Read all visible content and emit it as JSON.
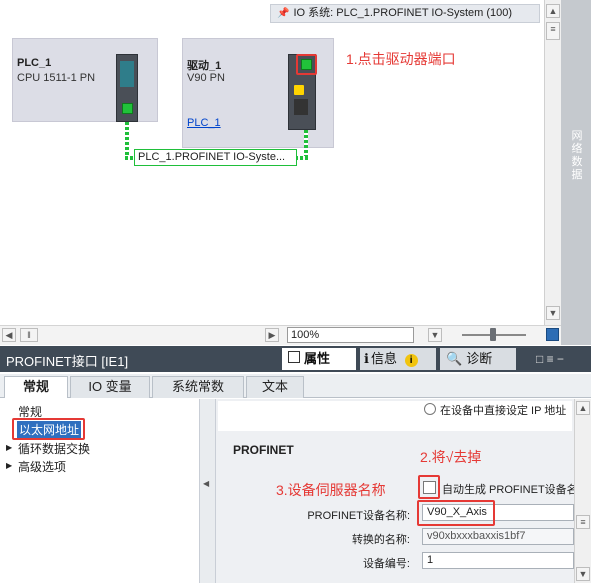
{
  "io_system_label": "IO 系统: PLC_1.PROFINET IO-System (100)",
  "devices": {
    "plc": {
      "name": "PLC_1",
      "type": "CPU 1511-1 PN"
    },
    "drive": {
      "name": "驱动_1",
      "type": "V90 PN",
      "link": "PLC_1"
    }
  },
  "network_label": "PLC_1.PROFINET IO-Syste...",
  "netview_label": "网络数据",
  "annotations": {
    "step1": "1.点击驱动器端口",
    "step2": "2.将√去掉",
    "step3": "3.设备伺服器名称"
  },
  "zoom": "100%",
  "panel": {
    "title": "PROFINET接口 [IE1]",
    "tabs": [
      "属性",
      "信息",
      "诊断"
    ]
  },
  "subtabs": [
    "常规",
    "IO 变量",
    "系统常数",
    "文本"
  ],
  "nav": {
    "items": [
      "常规",
      "以太网地址",
      "循环数据交换",
      "高级选项"
    ]
  },
  "settings": {
    "radio_label": "在设备中直接设定 IP 地址",
    "section": "PROFINET",
    "auto_label": "自动生成 PROFINET设备名",
    "name_label": "PROFINET设备名称:",
    "name_value": "V90_X_Axis",
    "conv_label": "转换的名称:",
    "conv_value": "v90xbxxxbaxxis1bf7",
    "num_label": "设备编号:",
    "num_value": "1"
  }
}
